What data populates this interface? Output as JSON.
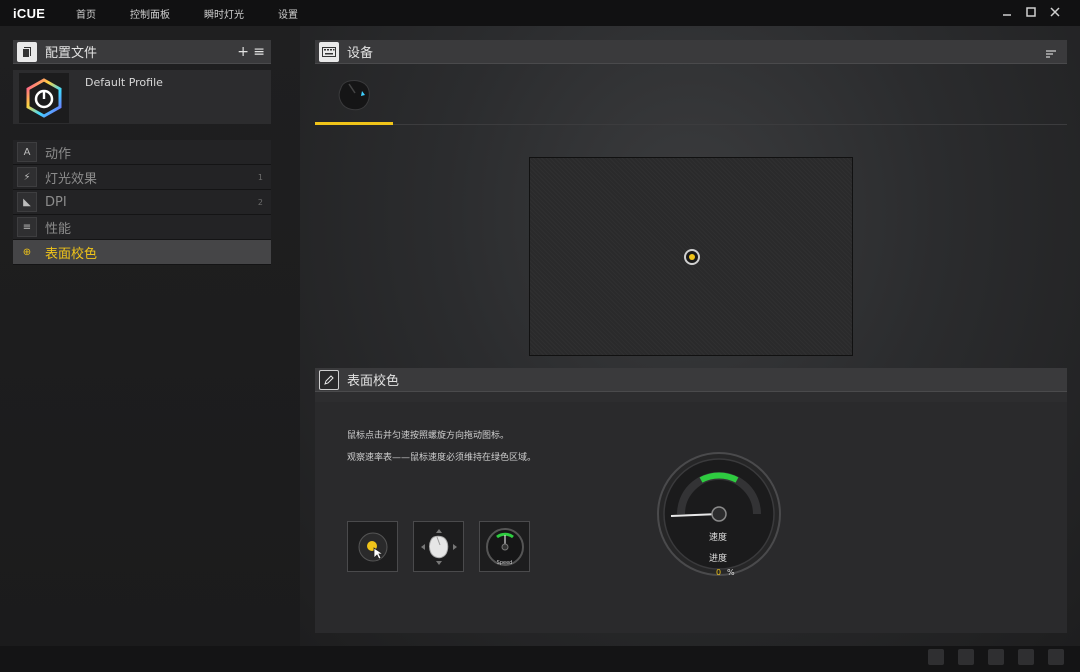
{
  "app": {
    "logo": "iCUE"
  },
  "topnav": [
    "首页",
    "控制面板",
    "瞬时灯光",
    "设置"
  ],
  "window_controls": [
    "minimize-icon",
    "maximize-icon",
    "close-icon"
  ],
  "profiles": {
    "title": "配置文件",
    "add_label": "+",
    "menu_label": "≡",
    "profile_name": "Default Profile"
  },
  "menu": [
    {
      "icon": "A",
      "label": "动作",
      "count": ""
    },
    {
      "icon": "⚡",
      "label": "灯光效果",
      "count": "1"
    },
    {
      "icon": "◣",
      "label": "DPI",
      "count": "2"
    },
    {
      "icon": "≡",
      "label": "性能",
      "count": ""
    },
    {
      "icon": "⊕",
      "label": "表面校色",
      "count": "",
      "active": true
    }
  ],
  "devices": {
    "title": "设备"
  },
  "calibration": {
    "title": "表面校色",
    "instruction1": "鼠标点击并匀速按照螺旋方向拖动图标。",
    "instruction2": "观察速率表——鼠标速度必须维持在绿色区域。",
    "tile3_label": "Speed",
    "gauge_speed_label": "速度",
    "progress_label": "进度",
    "progress_value": "0",
    "progress_unit": "%"
  },
  "colors": {
    "accent": "#f0c419",
    "green": "#2ecc40"
  }
}
